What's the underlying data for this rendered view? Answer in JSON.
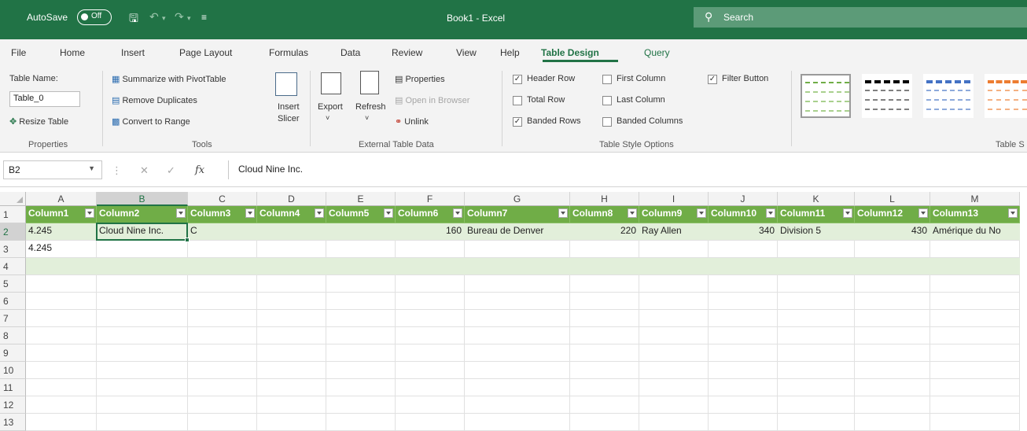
{
  "title_bar": {
    "autosave_label": "AutoSave",
    "autosave_state": "Off",
    "doc_title": "Book1 - Excel",
    "search_placeholder": "Search",
    "accent": "#217346"
  },
  "ribbon_tabs": [
    "File",
    "Home",
    "Insert",
    "Page Layout",
    "Formulas",
    "Data",
    "Review",
    "View",
    "Help",
    "Table Design",
    "Query"
  ],
  "active_tab": "Table Design",
  "ribbon": {
    "properties": {
      "table_name_label": "Table Name:",
      "table_name_value": "Table_0",
      "resize_table": "Resize Table",
      "group_label": "Properties"
    },
    "tools": {
      "summarize": "Summarize with PivotTable",
      "remove_duplicates": "Remove Duplicates",
      "convert_to_range": "Convert to Range",
      "insert_slicer_line1": "Insert",
      "insert_slicer_line2": "Slicer",
      "group_label": "Tools"
    },
    "external": {
      "export": "Export",
      "refresh": "Refresh",
      "properties": "Properties",
      "open_in_browser": "Open in Browser",
      "unlink": "Unlink",
      "group_label": "External Table Data"
    },
    "style_options": {
      "header_row": "Header Row",
      "total_row": "Total Row",
      "banded_rows": "Banded Rows",
      "first_column": "First Column",
      "last_column": "Last Column",
      "banded_columns": "Banded Columns",
      "filter_button": "Filter Button",
      "header_row_checked": true,
      "total_row_checked": false,
      "banded_rows_checked": true,
      "first_column_checked": false,
      "last_column_checked": false,
      "banded_columns_checked": false,
      "filter_button_checked": true,
      "group_label": "Table Style Options"
    },
    "table_styles": {
      "group_label": "Table S",
      "swatch_colors": [
        "#70ad47",
        "#000000",
        "#4472c4",
        "#ed7d31"
      ]
    }
  },
  "formula_bar": {
    "cell_ref": "B2",
    "fx_symbol": "fx",
    "content": "Cloud Nine Inc."
  },
  "grid": {
    "columns": [
      "A",
      "B",
      "C",
      "D",
      "E",
      "F",
      "G",
      "H",
      "I",
      "J",
      "K",
      "L",
      "M"
    ],
    "selected_column": "B",
    "rows": [
      "1",
      "2",
      "3",
      "4",
      "5",
      "6",
      "7",
      "8",
      "9",
      "10",
      "11",
      "12",
      "13"
    ],
    "selected_row": "2",
    "header_cells": [
      "Column1",
      "Column2",
      "Column3",
      "Column4",
      "Column5",
      "Column6",
      "Column7",
      "Column8",
      "Column9",
      "Column10",
      "Column11",
      "Column12",
      "Column13"
    ],
    "row2": {
      "A": "4.245",
      "B": "Cloud Nine Inc.",
      "C": "C",
      "F": "160",
      "G": "Bureau de Denver",
      "H": "220",
      "I": "Ray Allen",
      "J": "340",
      "K": "Division 5",
      "L": "430",
      "M": "Amérique du No"
    },
    "row3": {
      "A": "4.245"
    },
    "table_header_color": "#70ad47",
    "band_color": "#e2efda"
  }
}
